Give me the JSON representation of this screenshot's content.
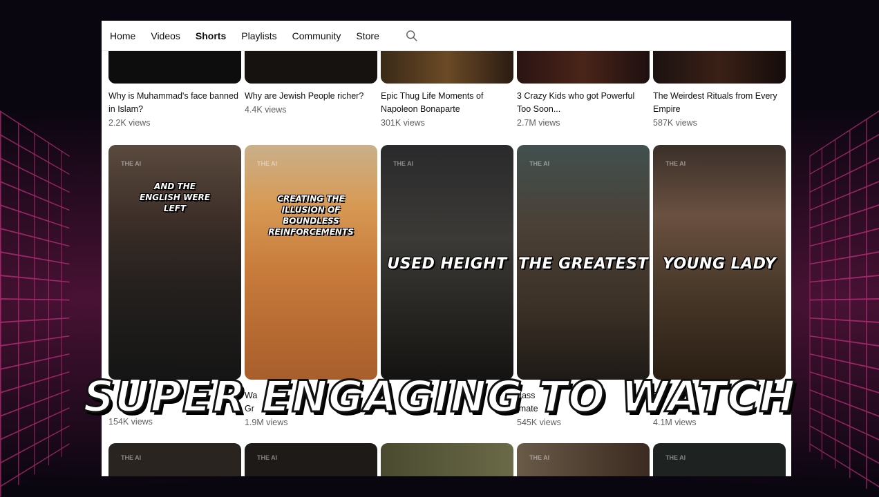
{
  "channel_tabs": {
    "home": "Home",
    "videos": "Videos",
    "shorts": "Shorts",
    "playlists": "Playlists",
    "community": "Community",
    "store": "Store",
    "search_icon": "search-icon"
  },
  "top_row": [
    {
      "title": "Why is Muhammad's face banned in Islam?",
      "views": "2.2K views"
    },
    {
      "title": "Why are Jewish People richer?",
      "views": "4.4K views"
    },
    {
      "title": "Epic Thug Life Moments of Napoleon Bonaparte",
      "views": "301K views"
    },
    {
      "title": "3 Crazy Kids who got Powerful Too Soon...",
      "views": "2.7M views"
    },
    {
      "title": "The Weirdest Rituals from Every Empire",
      "views": "587K views"
    }
  ],
  "middle_row": [
    {
      "overlay": "AND THE ENGLISH WERE LEFT",
      "title_visible": "",
      "views": "154K views"
    },
    {
      "overlay": "CREATING THE ILLUSION OF BOUNDLESS REINFORCEMENTS",
      "title_visible": "Wa",
      "title_line2": "Gr",
      "views": "1.9M views"
    },
    {
      "overlay": "USED HEIGHT",
      "title_visible": "",
      "views": ""
    },
    {
      "overlay": "THE GREATEST",
      "title_visible": "dass",
      "title_line2": "imate",
      "views": "545K views"
    },
    {
      "overlay": "YOUNG LADY",
      "title_visible": "P",
      "views": "4.1M views"
    }
  ],
  "watermark": "THE AI",
  "caption": "SUPER ENGAGING TO WATCH",
  "colors": {
    "accent_grid": "#ff3ca0",
    "background": "#0a0610"
  }
}
